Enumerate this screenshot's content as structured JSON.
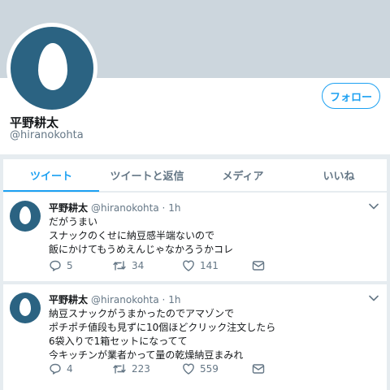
{
  "profile": {
    "display_name": "平野耕太",
    "handle": "@hiranokohta",
    "follow_label": "フォロー"
  },
  "tabs": [
    {
      "label": "ツイート",
      "active": true
    },
    {
      "label": "ツイートと返信",
      "active": false
    },
    {
      "label": "メディア",
      "active": false
    },
    {
      "label": "いいね",
      "active": false
    }
  ],
  "tweets": [
    {
      "name": "平野耕太",
      "handle": "@hiranokohta",
      "dot": "·",
      "time": "1h",
      "text": "だがうまい\nスナックのくせに納豆感半端ないので\n飯にかけてもうめえんじゃなかろうかコレ",
      "replies": "5",
      "retweets": "34",
      "likes": "141"
    },
    {
      "name": "平野耕太",
      "handle": "@hiranokohta",
      "dot": "·",
      "time": "1h",
      "text": "納豆スナックがうまかったのでアマゾンで\nポチポチ値段も見ずに10個ほどクリック注文したら\n6袋入りで1箱セットになってて\n今キッチンが業者かって量の乾燥納豆まみれ",
      "replies": "4",
      "retweets": "223",
      "likes": "559"
    }
  ],
  "colors": {
    "accent": "#1da1f2",
    "avatar_bg": "#2b6382",
    "banner": "#ccd6dd",
    "page_bg": "#e6ecf0",
    "muted": "#657786"
  },
  "icons": [
    "reply-icon",
    "retweet-icon",
    "like-icon",
    "dm-icon",
    "chevron-down-icon"
  ]
}
